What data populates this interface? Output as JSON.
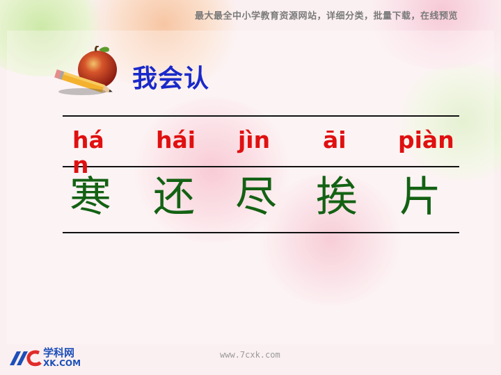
{
  "banner_text": "最大最全中小学教育资源网站，详细分类，批量下载，在线预览",
  "section_title": "我会认",
  "characters": [
    {
      "pinyin": "hán",
      "hanzi": "寒"
    },
    {
      "pinyin": "hái",
      "hanzi": "还"
    },
    {
      "pinyin": "jìn",
      "hanzi": "尽"
    },
    {
      "pinyin": "āi",
      "hanzi": "挨"
    },
    {
      "pinyin": "piàn",
      "hanzi": "片"
    }
  ],
  "logo": {
    "top_text": "学科网",
    "bottom_text": "XK.COM"
  },
  "footer_url": "www.7cxk.com",
  "colors": {
    "title": "#1a29c9",
    "pinyin": "#e01010",
    "hanzi": "#136113",
    "banner": "#7a7a7a",
    "background": "#fbf0f1"
  },
  "icons": {
    "title_art": "apple-with-pencil-icon",
    "brand_logo": "xkw-logo-icon"
  }
}
